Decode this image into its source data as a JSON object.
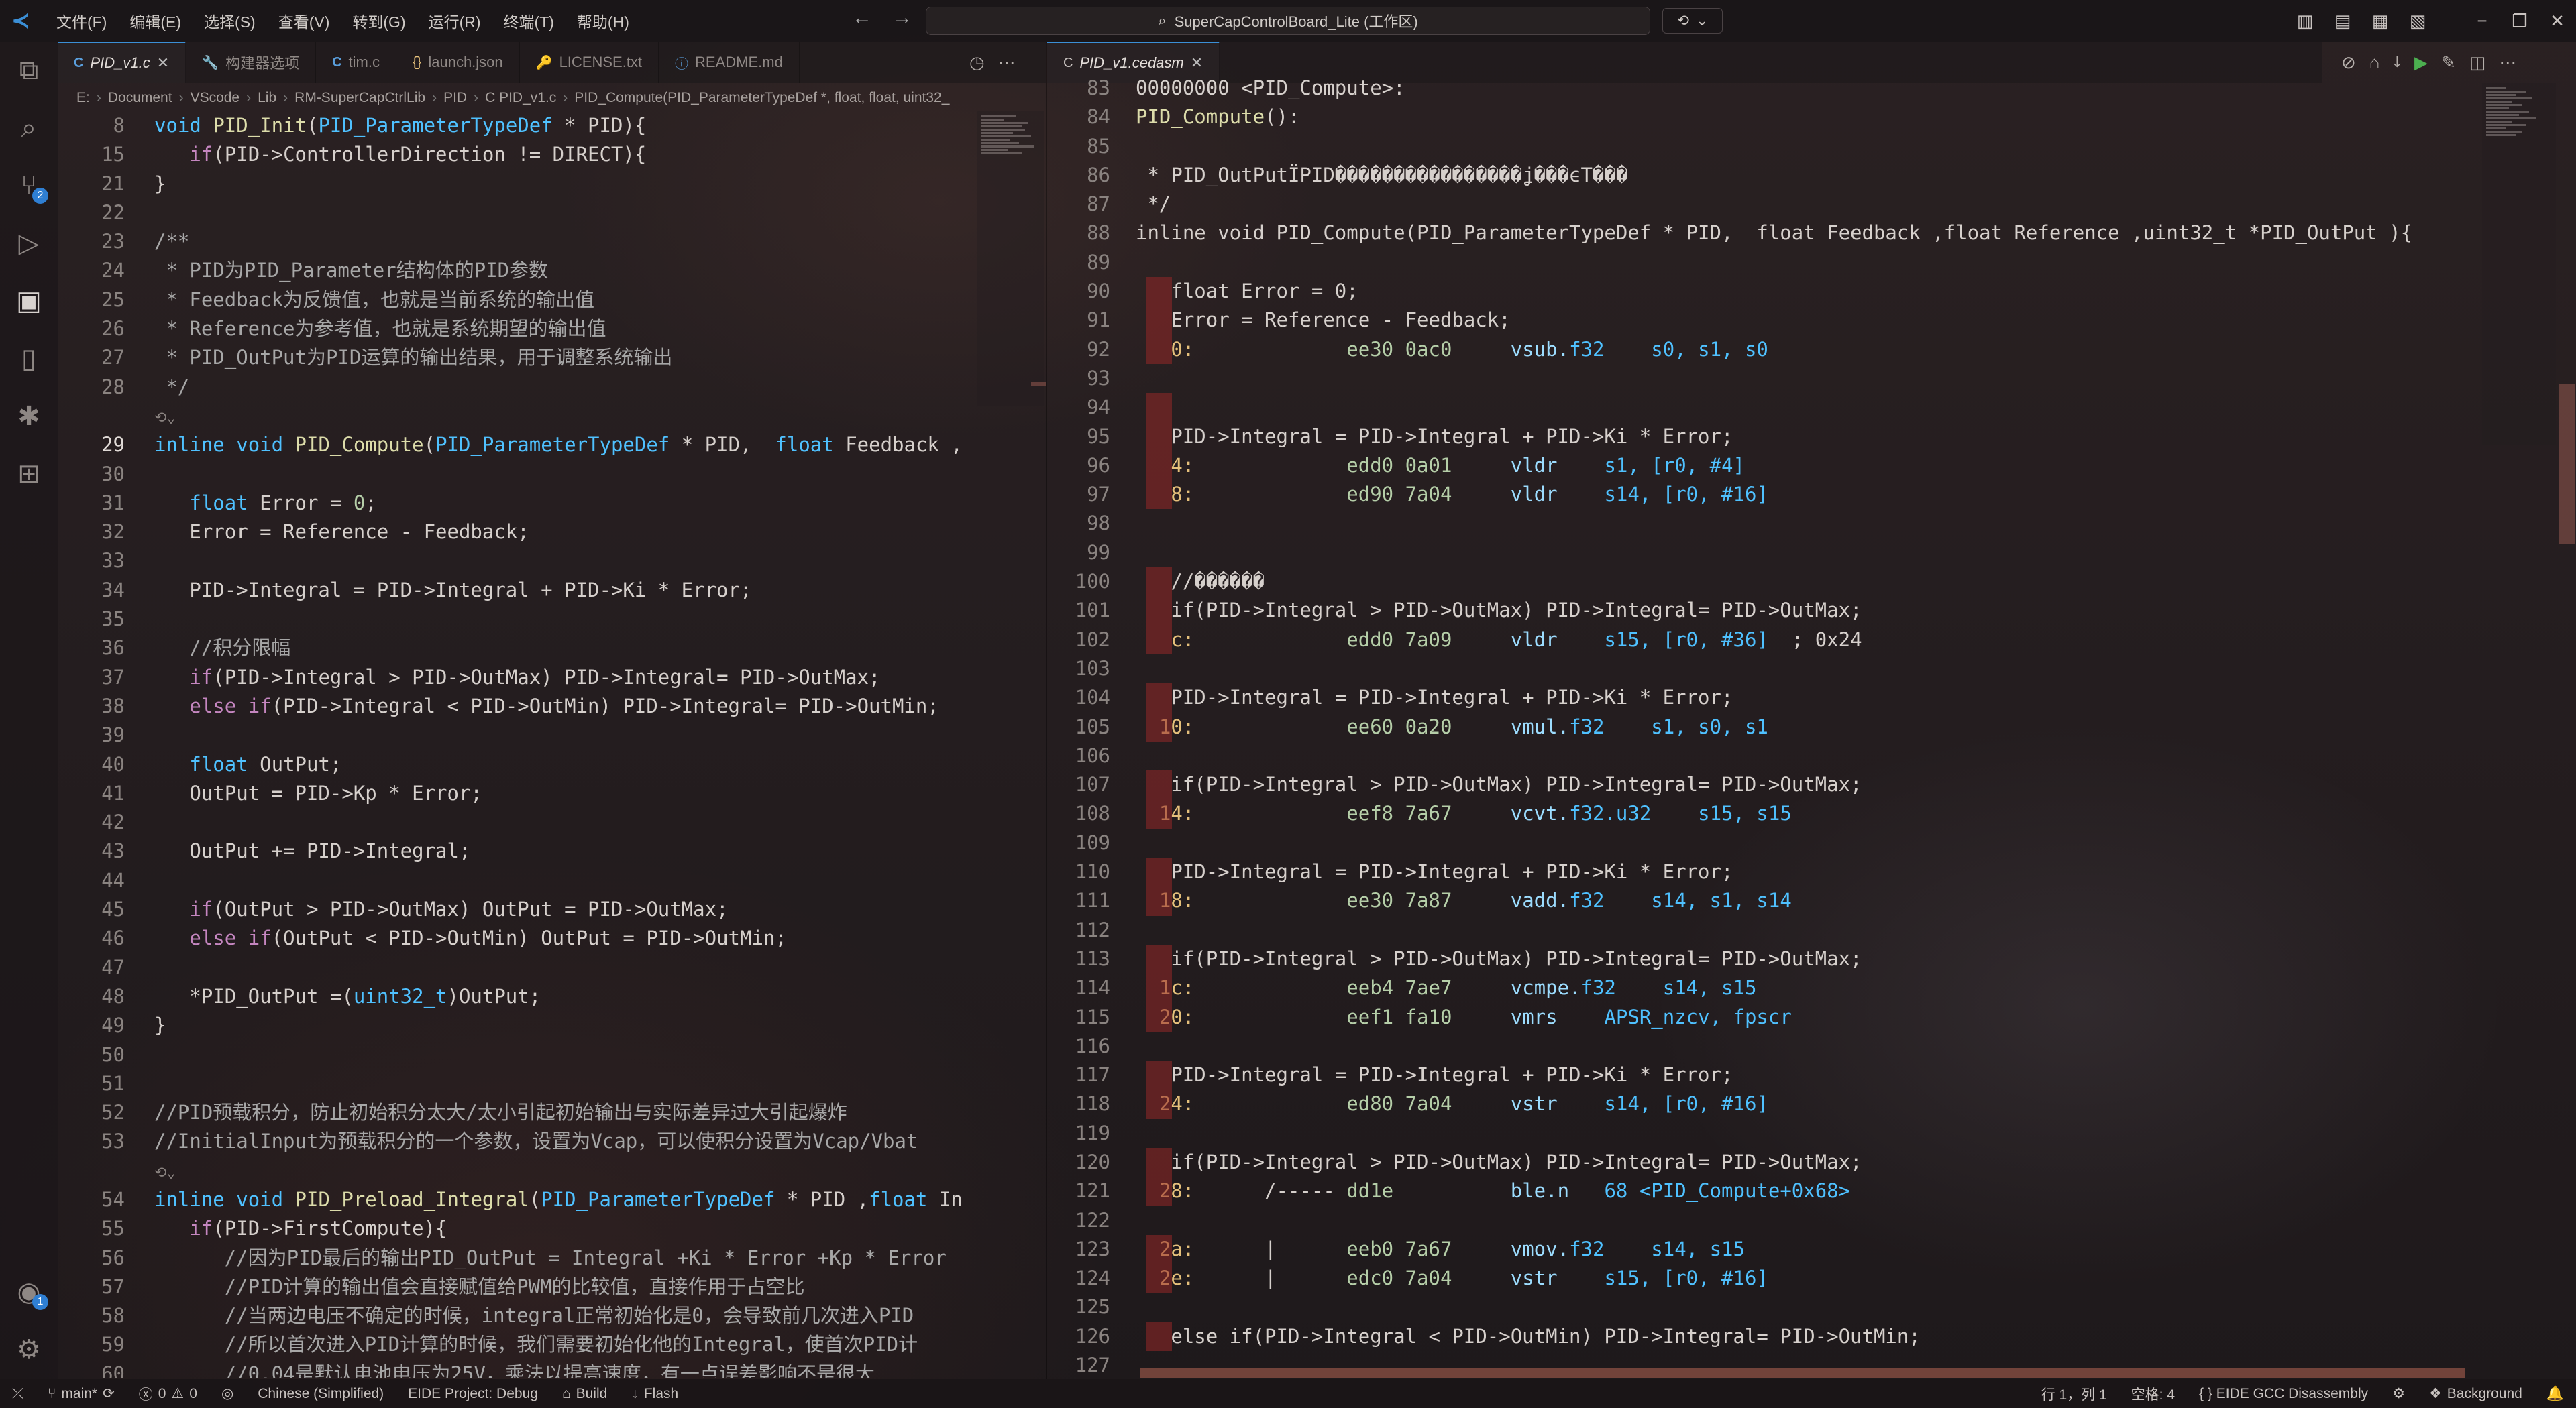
{
  "menu": [
    "文件(F)",
    "编辑(E)",
    "选择(S)",
    "查看(V)",
    "转到(G)",
    "运行(R)",
    "终端(T)",
    "帮助(H)"
  ],
  "search": {
    "label": "SuperCapControlBoard_Lite (工作区)"
  },
  "left_tabs": [
    {
      "icon": "C",
      "icon_class": "ti-c",
      "label": "PID_v1.c",
      "active": true
    },
    {
      "icon": "🔧",
      "icon_class": "ti-w",
      "label": "构建器选项",
      "active": false
    },
    {
      "icon": "C",
      "icon_class": "ti-c",
      "label": "tim.c",
      "active": false
    },
    {
      "icon": "{}",
      "icon_class": "ti-j",
      "label": "launch.json",
      "active": false
    },
    {
      "icon": "🔑",
      "icon_class": "ti-l",
      "label": "LICENSE.txt",
      "active": false
    },
    {
      "icon": "ⓘ",
      "icon_class": "ti-i",
      "label": "README.md",
      "active": false
    }
  ],
  "right_tab": {
    "icon": "C",
    "label": "PID_v1.cedasm"
  },
  "breadcrumb": [
    "E:",
    "Document",
    "VScode",
    "Lib",
    "RM-SuperCapCtrlLib",
    "PID",
    "C  PID_v1.c",
    "PID_Compute(PID_ParameterTypeDef *, float, float, uint32_"
  ],
  "left_code": [
    {
      "n": "8",
      "html": "<span class='ty'>void</span> <span class='fn'>PID_Init</span>(<span class='ty'>PID_ParameterTypeDef</span> * PID){"
    },
    {
      "n": "15",
      "html": "   <span class='kw'>if</span>(PID-&gt;ControllerDirection != DIRECT){"
    },
    {
      "n": "21",
      "html": "}"
    },
    {
      "n": "22",
      "html": ""
    },
    {
      "n": "23",
      "html": "<span class='cm'>/**</span>"
    },
    {
      "n": "24",
      "html": "<span class='cm'> * PID为PID_Parameter结构体的PID参数</span>"
    },
    {
      "n": "25",
      "html": "<span class='cm'> * Feedback为反馈值，也就是当前系统的输出值</span>"
    },
    {
      "n": "26",
      "html": "<span class='cm'> * Reference为参考值，也就是系统期望的输出值</span>"
    },
    {
      "n": "27",
      "html": "<span class='cm'> * PID_OutPut为PID运算的输出结果，用于调整系统输出</span>"
    },
    {
      "n": "28",
      "html": "<span class='cm'> */</span>"
    },
    {
      "n": "",
      "html": "<span class='fold-hint'>⟲⌄</span>"
    },
    {
      "n": "29",
      "cur": true,
      "html": "<span class='ty'>inline</span> <span class='ty'>void</span> <span class='fn'>PID_Compute</span>(<span class='ty'>PID_ParameterTypeDef</span> * PID,  <span class='ty'>float</span> Feedback ,"
    },
    {
      "n": "30",
      "html": ""
    },
    {
      "n": "31",
      "html": "   <span class='ty'>float</span> Error = <span class='num'>0</span>;"
    },
    {
      "n": "32",
      "html": "   Error = Reference - Feedback;"
    },
    {
      "n": "33",
      "html": ""
    },
    {
      "n": "34",
      "html": "   PID-&gt;Integral = PID-&gt;Integral + PID-&gt;Ki * Error;"
    },
    {
      "n": "35",
      "html": ""
    },
    {
      "n": "36",
      "html": "   <span class='cm'>//积分限幅</span>"
    },
    {
      "n": "37",
      "html": "   <span class='kw'>if</span>(PID-&gt;Integral &gt; PID-&gt;OutMax) PID-&gt;Integral= PID-&gt;OutMax;"
    },
    {
      "n": "38",
      "html": "   <span class='kw'>else</span> <span class='kw'>if</span>(PID-&gt;Integral &lt; PID-&gt;OutMin) PID-&gt;Integral= PID-&gt;OutMin;"
    },
    {
      "n": "39",
      "html": ""
    },
    {
      "n": "40",
      "html": "   <span class='ty'>float</span> OutPut;"
    },
    {
      "n": "41",
      "html": "   OutPut = PID-&gt;Kp * Error;"
    },
    {
      "n": "42",
      "html": ""
    },
    {
      "n": "43",
      "html": "   OutPut += PID-&gt;Integral;"
    },
    {
      "n": "44",
      "html": ""
    },
    {
      "n": "45",
      "html": "   <span class='kw'>if</span>(OutPut &gt; PID-&gt;OutMax) OutPut = PID-&gt;OutMax;"
    },
    {
      "n": "46",
      "html": "   <span class='kw'>else</span> <span class='kw'>if</span>(OutPut &lt; PID-&gt;OutMin) OutPut = PID-&gt;OutMin;"
    },
    {
      "n": "47",
      "html": ""
    },
    {
      "n": "48",
      "html": "   *PID_OutPut =(<span class='ty'>uint32_t</span>)OutPut;"
    },
    {
      "n": "49",
      "html": "}"
    },
    {
      "n": "50",
      "html": ""
    },
    {
      "n": "51",
      "html": ""
    },
    {
      "n": "52",
      "html": "<span class='cm'>//PID预载积分，防止初始积分太大/太小引起初始输出与实际差异过大引起爆炸</span>"
    },
    {
      "n": "53",
      "html": "<span class='cm'>//InitialInput为预载积分的一个参数，设置为Vcap，可以使积分设置为Vcap/Vbat</span>"
    },
    {
      "n": "",
      "html": "<span class='fold-hint'>⟲⌄</span>"
    },
    {
      "n": "54",
      "html": "<span class='ty'>inline</span> <span class='ty'>void</span> <span class='fn'>PID_Preload_Integral</span>(<span class='ty'>PID_ParameterTypeDef</span> * PID ,<span class='ty'>float</span> In"
    },
    {
      "n": "55",
      "html": "   <span class='kw'>if</span>(PID-&gt;FirstCompute){"
    },
    {
      "n": "56",
      "html": "      <span class='cm'>//因为PID最后的输出PID_OutPut = Integral +Ki * Error +Kp * Error</span>"
    },
    {
      "n": "57",
      "html": "      <span class='cm'>//PID计算的输出值会直接赋值给PWM的比较值，直接作用于占空比</span>"
    },
    {
      "n": "58",
      "html": "      <span class='cm'>//当两边电压不确定的时候，integral正常初始化是0，会导致前几次进入PID</span>"
    },
    {
      "n": "59",
      "html": "      <span class='cm'>//所以首次进入PID计算的时候，我们需要初始化他的Integral，使首次PID计</span>"
    },
    {
      "n": "60",
      "html": "      <span class='cm'>//0.04是默认电池电压为25V，乘法以提高速度，有一点误差影响不是很大</span>"
    }
  ],
  "right_code": [
    {
      "n": "83",
      "html": "00000000 &lt;PID_Compute&gt;:"
    },
    {
      "n": "84",
      "html": "<span class='fn'>PID_Compute</span>():"
    },
    {
      "n": "85",
      "html": ""
    },
    {
      "n": "86",
      "html": " * PID_OutPutÏPID����������������ʝ���ϵT���"
    },
    {
      "n": "87",
      "html": " */"
    },
    {
      "n": "88",
      "html": "inline void PID_Compute(PID_ParameterTypeDef * PID,  float Feedback ,float Reference ,uint32_t *PID_OutPut ){"
    },
    {
      "n": "89",
      "html": ""
    },
    {
      "n": "90",
      "mark": true,
      "html": "   float Error = 0;"
    },
    {
      "n": "91",
      "mark": true,
      "html": "   Error = Reference - Feedback;"
    },
    {
      "n": "92",
      "mark": true,
      "html": "   <span class='addr'>0:</span>             <span class='num'>ee30 0ac0</span>     <span class='instr'>vsub.</span><span class='reg'>f32</span>    <span class='reg'>s0, s1, s0</span>"
    },
    {
      "n": "93",
      "html": ""
    },
    {
      "n": "94",
      "mark": true,
      "html": ""
    },
    {
      "n": "95",
      "mark": true,
      "html": "   PID-&gt;Integral = PID-&gt;Integral + PID-&gt;Ki * Error;"
    },
    {
      "n": "96",
      "mark": true,
      "html": "   <span class='addr'>4:</span>             <span class='num'>edd0 0a01</span>     <span class='instr'>vldr</span>    <span class='reg'>s1, [r0, #4]</span>"
    },
    {
      "n": "97",
      "mark": true,
      "html": "   <span class='addr'>8:</span>             <span class='num'>ed90 7a04</span>     <span class='instr'>vldr</span>    <span class='reg'>s14, [r0, #16]</span>"
    },
    {
      "n": "98",
      "html": ""
    },
    {
      "n": "99",
      "html": ""
    },
    {
      "n": "100",
      "mark": true,
      "html": "   //������"
    },
    {
      "n": "101",
      "mark": true,
      "html": "   if(PID-&gt;Integral &gt; PID-&gt;OutMax) PID-&gt;Integral= PID-&gt;OutMax;"
    },
    {
      "n": "102",
      "mark": true,
      "html": "   <span class='addr'>c:</span>             <span class='num'>edd0 7a09</span>     <span class='instr'>vldr</span>    <span class='reg'>s15, [r0, #36]</span>  ; 0x24"
    },
    {
      "n": "103",
      "html": ""
    },
    {
      "n": "104",
      "mark": true,
      "html": "   PID-&gt;Integral = PID-&gt;Integral + PID-&gt;Ki * Error;"
    },
    {
      "n": "105",
      "mark": true,
      "html": "  <span class='addr'>10:</span>             <span class='num'>ee60 0a20</span>     <span class='instr'>vmul.</span><span class='reg'>f32</span>    <span class='reg'>s1, s0, s1</span>"
    },
    {
      "n": "106",
      "html": ""
    },
    {
      "n": "107",
      "mark": true,
      "html": "   if(PID-&gt;Integral &gt; PID-&gt;OutMax) PID-&gt;Integral= PID-&gt;OutMax;"
    },
    {
      "n": "108",
      "mark": true,
      "html": "  <span class='addr'>14:</span>             <span class='num'>eef8 7a67</span>     <span class='instr'>vcvt.</span><span class='reg'>f32.u32</span>    <span class='reg'>s15, s15</span>"
    },
    {
      "n": "109",
      "html": ""
    },
    {
      "n": "110",
      "mark": true,
      "html": "   PID-&gt;Integral = PID-&gt;Integral + PID-&gt;Ki * Error;"
    },
    {
      "n": "111",
      "mark": true,
      "html": "  <span class='addr'>18:</span>             <span class='num'>ee30 7a87</span>     <span class='instr'>vadd.</span><span class='reg'>f32</span>    <span class='reg'>s14, s1, s14</span>"
    },
    {
      "n": "112",
      "html": ""
    },
    {
      "n": "113",
      "mark": true,
      "html": "   if(PID-&gt;Integral &gt; PID-&gt;OutMax) PID-&gt;Integral= PID-&gt;OutMax;"
    },
    {
      "n": "114",
      "mark": true,
      "html": "  <span class='addr'>1c:</span>             <span class='num'>eeb4 7ae7</span>     <span class='instr'>vcmpe.</span><span class='reg'>f32</span>    <span class='reg'>s14, s15</span>"
    },
    {
      "n": "115",
      "mark": true,
      "html": "  <span class='addr'>20:</span>             <span class='num'>eef1 fa10</span>     <span class='instr'>vmrs</span>    <span class='reg'>APSR_nzcv, fpscr</span>"
    },
    {
      "n": "116",
      "html": ""
    },
    {
      "n": "117",
      "mark": true,
      "html": "   PID-&gt;Integral = PID-&gt;Integral + PID-&gt;Ki * Error;"
    },
    {
      "n": "118",
      "mark": true,
      "html": "  <span class='addr'>24:</span>             <span class='num'>ed80 7a04</span>     <span class='instr'>vstr</span>    <span class='reg'>s14, [r0, #16]</span>"
    },
    {
      "n": "119",
      "html": ""
    },
    {
      "n": "120",
      "mark": true,
      "html": "   if(PID-&gt;Integral &gt; PID-&gt;OutMax) PID-&gt;Integral= PID-&gt;OutMax;"
    },
    {
      "n": "121",
      "mark": true,
      "html": "  <span class='addr'>28:</span>      /----- <span class='num'>dd1e</span>          <span class='instr'>ble.n</span>   <span class='reg'>68 &lt;PID_Compute+0x68&gt;</span>"
    },
    {
      "n": "122",
      "html": ""
    },
    {
      "n": "123",
      "mark": true,
      "html": "  <span class='addr'>2a:</span>      |      <span class='num'>eeb0 7a67</span>     <span class='instr'>vmov.</span><span class='reg'>f32</span>    <span class='reg'>s14, s15</span>"
    },
    {
      "n": "124",
      "mark": true,
      "html": "  <span class='addr'>2e:</span>      |      <span class='num'>edc0 7a04</span>     <span class='instr'>vstr</span>    <span class='reg'>s15, [r0, #16]</span>"
    },
    {
      "n": "125",
      "html": ""
    },
    {
      "n": "126",
      "mark": true,
      "html": "   else if(PID-&gt;Integral &lt; PID-&gt;OutMin) PID-&gt;Integral= PID-&gt;OutMin;"
    },
    {
      "n": "127",
      "html": ""
    }
  ],
  "status": {
    "branch": "main*",
    "errors": "0",
    "warnings": "0",
    "language_pack": "Chinese (Simplified)",
    "eide_project": "EIDE Project: Debug",
    "build": "Build",
    "flash": "Flash",
    "position": "行 1，列 1",
    "spaces": "空格: 4",
    "mode": "{ }  EIDE GCC Disassembly",
    "background": "Background"
  }
}
